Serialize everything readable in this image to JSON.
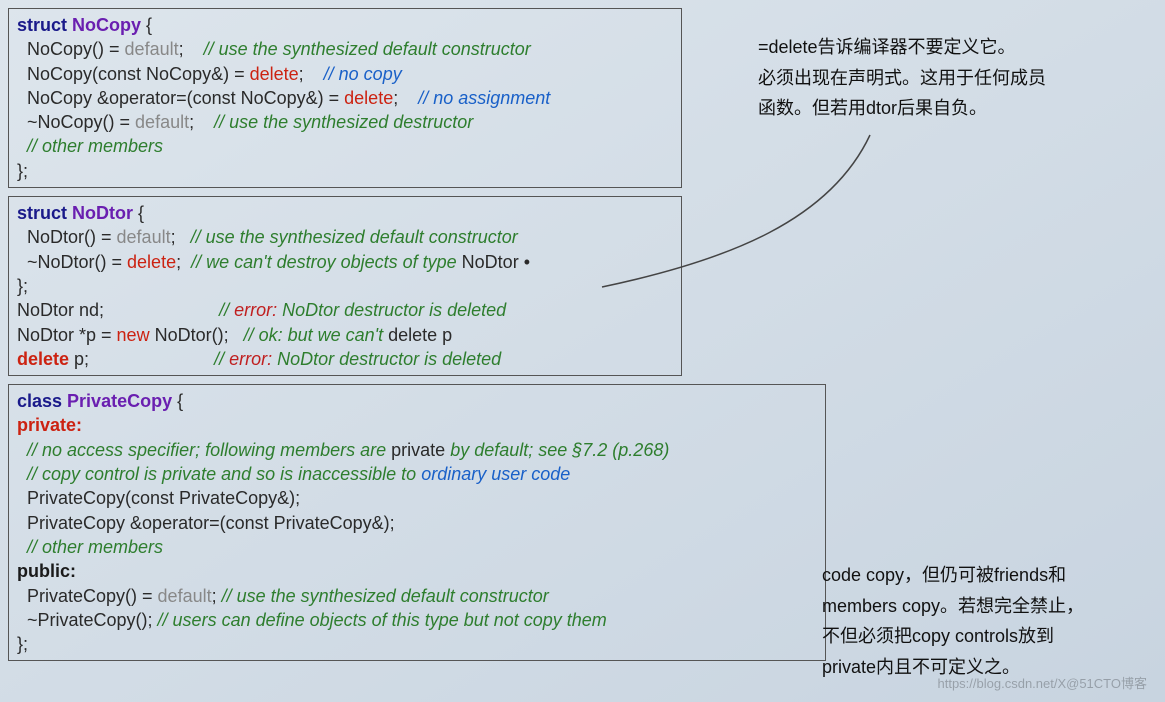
{
  "box1": {
    "l1a": "struct ",
    "l1b": "NoCopy",
    "l1c": " {",
    "l2a": "  NoCopy() = ",
    "l2b": "default",
    "l2c": ";    ",
    "l2d": "// use the synthesized default constructor",
    "l3a": "  NoCopy(const NoCopy&) = ",
    "l3b": "delete",
    "l3c": ";    ",
    "l3d": "// no copy",
    "l4a": "  NoCopy &operator=(const NoCopy&) = ",
    "l4b": "delete",
    "l4c": ";    ",
    "l4d": "// no assignment",
    "l5a": "  ~NoCopy() = ",
    "l5b": "default",
    "l5c": ";    ",
    "l5d": "// use the synthesized destructor",
    "l6": "  // other members",
    "l7": "};"
  },
  "box2": {
    "l1a": "struct ",
    "l1b": "NoDtor",
    "l1c": " {",
    "l2a": "  NoDtor() = ",
    "l2b": "default",
    "l2c": ";   ",
    "l2d": "// use the synthesized default constructor",
    "l3a": "  ~NoDtor() = ",
    "l3b": "delete",
    "l3c": ";  ",
    "l3d": "// we can't destroy objects of type",
    "l3e": " NoDtor •",
    "l4": "};",
    "l5a": "NoDtor nd;",
    "l5b": "                       // ",
    "l5c": "error: ",
    "l5d": "NoDtor destructor is deleted",
    "l6a": "NoDtor *p = ",
    "l6b": "new",
    "l6c": " NoDtor();   ",
    "l6d": "// ok: but we can't",
    "l6e": " delete p",
    "l7a": "delete",
    "l7b": " p;",
    "l7c": "                         // ",
    "l7d": "error: ",
    "l7e": "NoDtor destructor is deleted"
  },
  "box3": {
    "l1a": "class ",
    "l1b": "PrivateCopy",
    "l1c": " {",
    "l2": "private:",
    "l3a": "  // no access specifier; following members are",
    "l3b": " private ",
    "l3c": "by default; see §7.2 (p.268)",
    "l4a": "  // copy control is private and so is inaccessible to",
    "l4b": " ordinary user code",
    "l5": "  PrivateCopy(const PrivateCopy&);",
    "l6": "  PrivateCopy &operator=(const PrivateCopy&);",
    "l7": "  // other members",
    "l8": "public:",
    "l9a": "  PrivateCopy() = ",
    "l9b": "default",
    "l9c": "; ",
    "l9d": "// use the synthesized default constructor",
    "l10a": "  ~PrivateCopy(); ",
    "l10b": "// users can define objects of this type but not copy them",
    "l11": "};"
  },
  "notes": {
    "top_l1": "=delete告诉编译器不要定义它。",
    "top_l2": "必须出现在声明式。这用于任何成员",
    "top_l3": "函数。但若用dtor后果自负。",
    "bot_l1": "code copy，但仍可被friends和",
    "bot_l2": "members copy。若想完全禁止，",
    "bot_l3": "不但必须把copy controls放到",
    "bot_l4": "private内且不可定义之。"
  },
  "watermark": "https://blog.csdn.net/X@51CTO博客"
}
